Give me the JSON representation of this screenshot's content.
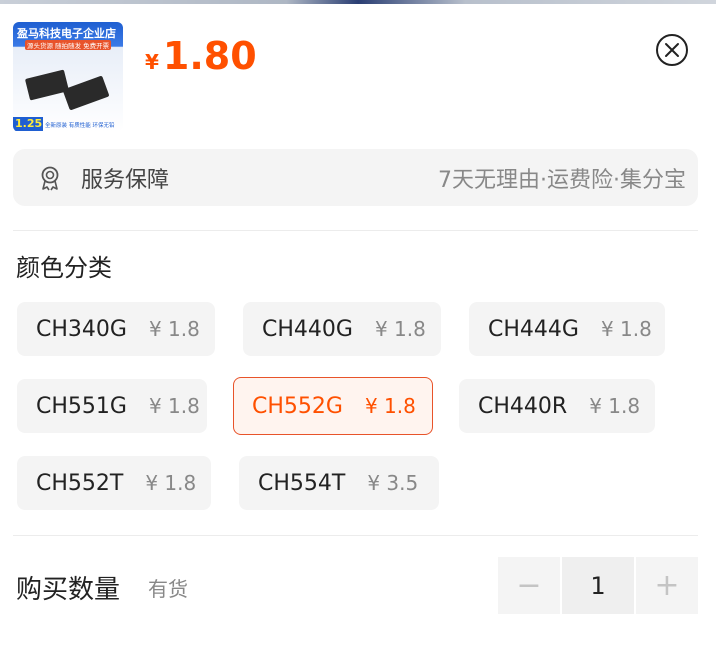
{
  "product": {
    "thumbnail": {
      "store_name": "盈马科技电子企业店",
      "tag": "源头货源 随拍随发 免费开票",
      "price_badge": "1.25",
      "badges": "全新原装 有质性能 环保无铅"
    },
    "currency": "¥",
    "price": "1.80"
  },
  "service": {
    "icon": "ribbon-badge-icon",
    "label": "服务保障",
    "description": "7天无理由·运费险·集分宝"
  },
  "variants": {
    "title": "颜色分类",
    "options": [
      {
        "name": "CH340G",
        "price": "¥ 1.8",
        "selected": false
      },
      {
        "name": "CH440G",
        "price": "¥ 1.8",
        "selected": false
      },
      {
        "name": "CH444G",
        "price": "¥ 1.8",
        "selected": false
      },
      {
        "name": "CH551G",
        "price": "¥ 1.8",
        "selected": false
      },
      {
        "name": "CH552G",
        "price": "¥ 1.8",
        "selected": true
      },
      {
        "name": "CH440R",
        "price": "¥ 1.8",
        "selected": false
      },
      {
        "name": "CH552T",
        "price": "¥ 1.8",
        "selected": false
      },
      {
        "name": "CH554T",
        "price": "¥ 3.5",
        "selected": false
      }
    ]
  },
  "quantity": {
    "label": "购买数量",
    "stock": "有货",
    "value": "1",
    "decrement": "−",
    "increment": "+"
  },
  "colors": {
    "accent": "#ff5000",
    "selected_border": "#e8532a",
    "chip_bg": "#f4f4f4"
  }
}
